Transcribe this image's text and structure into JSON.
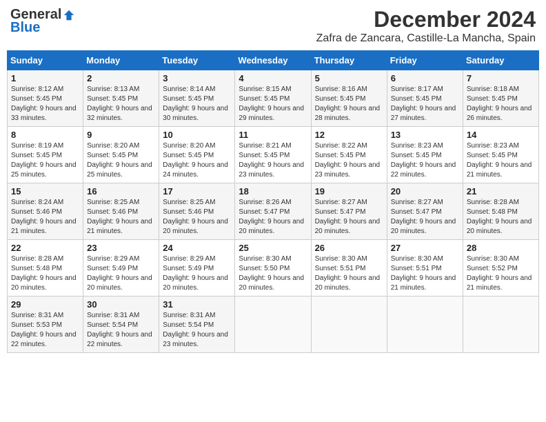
{
  "logo": {
    "general": "General",
    "blue": "Blue"
  },
  "title": {
    "month": "December 2024",
    "location": "Zafra de Zancara, Castille-La Mancha, Spain"
  },
  "headers": [
    "Sunday",
    "Monday",
    "Tuesday",
    "Wednesday",
    "Thursday",
    "Friday",
    "Saturday"
  ],
  "weeks": [
    [
      {
        "day": "1",
        "sunrise": "8:12 AM",
        "sunset": "5:45 PM",
        "daylight": "9 hours and 33 minutes."
      },
      {
        "day": "2",
        "sunrise": "8:13 AM",
        "sunset": "5:45 PM",
        "daylight": "9 hours and 32 minutes."
      },
      {
        "day": "3",
        "sunrise": "8:14 AM",
        "sunset": "5:45 PM",
        "daylight": "9 hours and 30 minutes."
      },
      {
        "day": "4",
        "sunrise": "8:15 AM",
        "sunset": "5:45 PM",
        "daylight": "9 hours and 29 minutes."
      },
      {
        "day": "5",
        "sunrise": "8:16 AM",
        "sunset": "5:45 PM",
        "daylight": "9 hours and 28 minutes."
      },
      {
        "day": "6",
        "sunrise": "8:17 AM",
        "sunset": "5:45 PM",
        "daylight": "9 hours and 27 minutes."
      },
      {
        "day": "7",
        "sunrise": "8:18 AM",
        "sunset": "5:45 PM",
        "daylight": "9 hours and 26 minutes."
      }
    ],
    [
      {
        "day": "8",
        "sunrise": "8:19 AM",
        "sunset": "5:45 PM",
        "daylight": "9 hours and 25 minutes."
      },
      {
        "day": "9",
        "sunrise": "8:20 AM",
        "sunset": "5:45 PM",
        "daylight": "9 hours and 25 minutes."
      },
      {
        "day": "10",
        "sunrise": "8:20 AM",
        "sunset": "5:45 PM",
        "daylight": "9 hours and 24 minutes."
      },
      {
        "day": "11",
        "sunrise": "8:21 AM",
        "sunset": "5:45 PM",
        "daylight": "9 hours and 23 minutes."
      },
      {
        "day": "12",
        "sunrise": "8:22 AM",
        "sunset": "5:45 PM",
        "daylight": "9 hours and 23 minutes."
      },
      {
        "day": "13",
        "sunrise": "8:23 AM",
        "sunset": "5:45 PM",
        "daylight": "9 hours and 22 minutes."
      },
      {
        "day": "14",
        "sunrise": "8:23 AM",
        "sunset": "5:45 PM",
        "daylight": "9 hours and 21 minutes."
      }
    ],
    [
      {
        "day": "15",
        "sunrise": "8:24 AM",
        "sunset": "5:46 PM",
        "daylight": "9 hours and 21 minutes."
      },
      {
        "day": "16",
        "sunrise": "8:25 AM",
        "sunset": "5:46 PM",
        "daylight": "9 hours and 21 minutes."
      },
      {
        "day": "17",
        "sunrise": "8:25 AM",
        "sunset": "5:46 PM",
        "daylight": "9 hours and 20 minutes."
      },
      {
        "day": "18",
        "sunrise": "8:26 AM",
        "sunset": "5:47 PM",
        "daylight": "9 hours and 20 minutes."
      },
      {
        "day": "19",
        "sunrise": "8:27 AM",
        "sunset": "5:47 PM",
        "daylight": "9 hours and 20 minutes."
      },
      {
        "day": "20",
        "sunrise": "8:27 AM",
        "sunset": "5:47 PM",
        "daylight": "9 hours and 20 minutes."
      },
      {
        "day": "21",
        "sunrise": "8:28 AM",
        "sunset": "5:48 PM",
        "daylight": "9 hours and 20 minutes."
      }
    ],
    [
      {
        "day": "22",
        "sunrise": "8:28 AM",
        "sunset": "5:48 PM",
        "daylight": "9 hours and 20 minutes."
      },
      {
        "day": "23",
        "sunrise": "8:29 AM",
        "sunset": "5:49 PM",
        "daylight": "9 hours and 20 minutes."
      },
      {
        "day": "24",
        "sunrise": "8:29 AM",
        "sunset": "5:49 PM",
        "daylight": "9 hours and 20 minutes."
      },
      {
        "day": "25",
        "sunrise": "8:30 AM",
        "sunset": "5:50 PM",
        "daylight": "9 hours and 20 minutes."
      },
      {
        "day": "26",
        "sunrise": "8:30 AM",
        "sunset": "5:51 PM",
        "daylight": "9 hours and 20 minutes."
      },
      {
        "day": "27",
        "sunrise": "8:30 AM",
        "sunset": "5:51 PM",
        "daylight": "9 hours and 21 minutes."
      },
      {
        "day": "28",
        "sunrise": "8:30 AM",
        "sunset": "5:52 PM",
        "daylight": "9 hours and 21 minutes."
      }
    ],
    [
      {
        "day": "29",
        "sunrise": "8:31 AM",
        "sunset": "5:53 PM",
        "daylight": "9 hours and 22 minutes."
      },
      {
        "day": "30",
        "sunrise": "8:31 AM",
        "sunset": "5:54 PM",
        "daylight": "9 hours and 22 minutes."
      },
      {
        "day": "31",
        "sunrise": "8:31 AM",
        "sunset": "5:54 PM",
        "daylight": "9 hours and 23 minutes."
      },
      null,
      null,
      null,
      null
    ]
  ],
  "labels": {
    "sunrise": "Sunrise:",
    "sunset": "Sunset:",
    "daylight": "Daylight:"
  }
}
